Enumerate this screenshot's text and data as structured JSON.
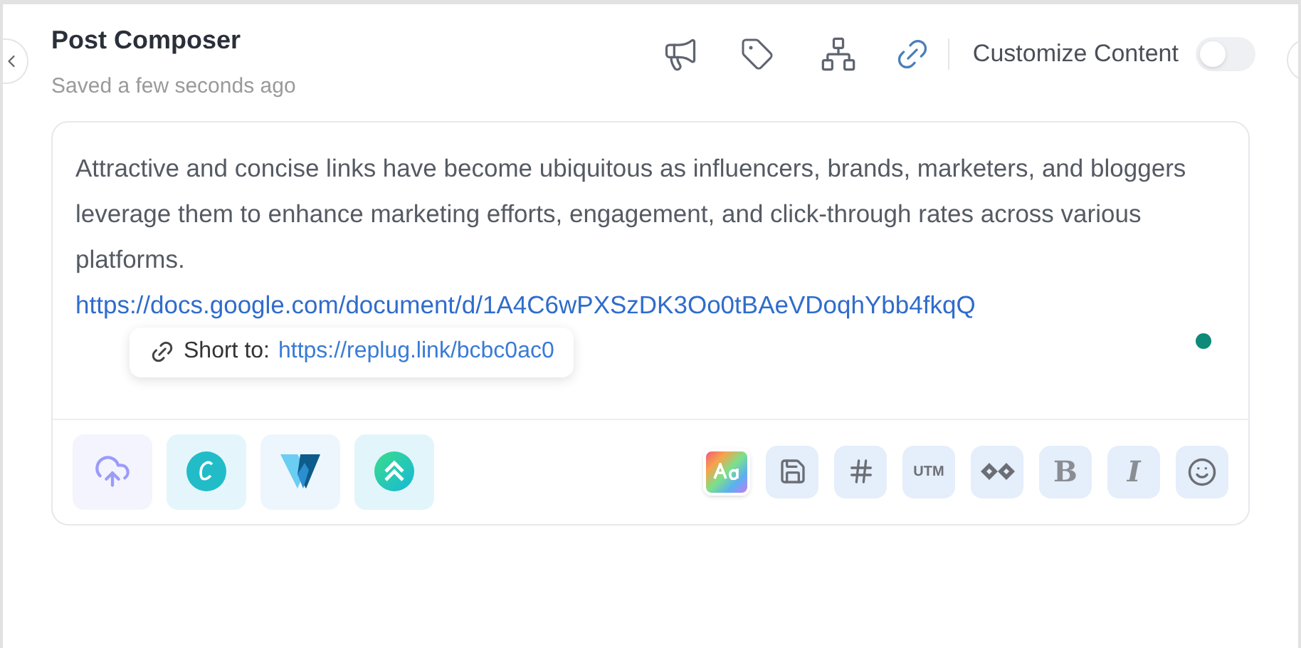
{
  "header": {
    "title": "Post Composer",
    "status": "Saved a few seconds ago"
  },
  "toggle": {
    "label": "Customize Content",
    "on": false
  },
  "editor": {
    "text": "Attractive and concise links have become ubiquitous as influencers, brands, marketers, and bloggers leverage them to enhance marketing efforts, engagement, and click-through rates across various platforms.",
    "link": "https://docs.google.com/document/d/1A4C6wPXSzDK3Oo0tBAeVDoqhYbb4fkqQ"
  },
  "shortener": {
    "label": "Short to:",
    "link": "https://replug.link/bcbc0ac0"
  },
  "attachments": [
    {
      "kind": "upload"
    },
    {
      "kind": "canva"
    },
    {
      "kind": "vista"
    },
    {
      "kind": "arrows"
    }
  ],
  "format_tools": [
    {
      "kind": "font"
    },
    {
      "kind": "save"
    },
    {
      "kind": "hashtag"
    },
    {
      "kind": "utm",
      "label": "UTM"
    },
    {
      "kind": "infinity"
    },
    {
      "kind": "bold",
      "label": "B"
    },
    {
      "kind": "italic",
      "label": "I"
    },
    {
      "kind": "emoji"
    }
  ]
}
